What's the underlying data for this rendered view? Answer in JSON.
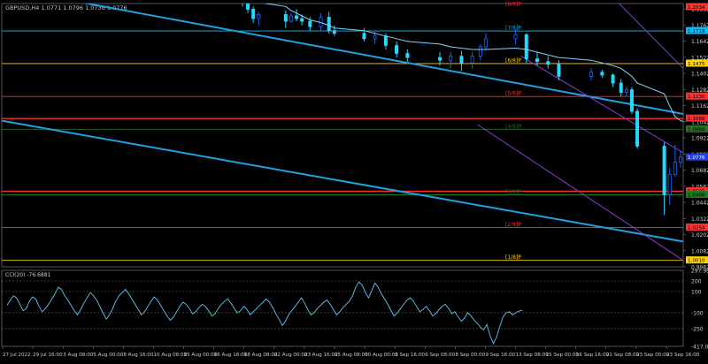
{
  "header": {
    "symbol": "GBPUSD,H4",
    "ohlc": "1.0771 1.0796 1.0736 1.0776"
  },
  "chart_data": [
    {
      "type": "line",
      "name": "price",
      "ylim": [
        0.9962,
        1.1922
      ],
      "y_ticks": [
        1.1882,
        1.1762,
        1.1642,
        1.1522,
        1.1402,
        1.1282,
        1.1162,
        1.1042,
        1.0922,
        1.0802,
        1.0682,
        1.0562,
        1.0442,
        1.0322,
        1.0202,
        1.0082,
        0.9962
      ],
      "x_ticks": [
        "27 Jul 2022",
        "29 Jul 16:00",
        "3 Aug 08:00",
        "5 Aug 00:00",
        "8 Aug 16:00",
        "10 Aug 08:00",
        "15 Aug 00:00",
        "16 Aug 16:00",
        "18 Aug 08:00",
        "22 Aug 00:00",
        "23 Aug 16:00",
        "25 Aug 08:00",
        "30 Aug 00:00",
        "1 Sep 16:00",
        "6 Sep 08:00",
        "8 Sep 00:00",
        "9 Sep 16:00",
        "13 Sep 08:00",
        "15 Sep 00:00",
        "16 Sep 16:00",
        "21 Sep 08:00",
        "23 Sep 00:00",
        "23 Sep 16:00"
      ],
      "current_price": "1.0776",
      "levels": [
        {
          "label": "[8/8]P",
          "price": "1.2034",
          "color": "#ff3333",
          "kind": "murrey"
        },
        {
          "label": "[7/8]P",
          "price": "1.1718",
          "color": "#00bfff",
          "kind": "murrey"
        },
        {
          "label": "[6/8]P",
          "price": "1.1475",
          "color": "#ffd400",
          "kind": "murrey"
        },
        {
          "label": "[5/8]P",
          "price": "1.1230",
          "color": "#ff3333",
          "kind": "murrey"
        },
        {
          "label": "",
          "price": "1.1066",
          "color": "#ff2a2a",
          "kind": "line"
        },
        {
          "label": "[4/8]P",
          "price": "1.0986",
          "color": "#2a6e2a",
          "kind": "murrey"
        },
        {
          "label": "",
          "price": "1.0525",
          "color": "#ff2a2a",
          "kind": "line"
        },
        {
          "label": "[3/8]P",
          "price": "1.0498",
          "color": "#1f7a1f",
          "kind": "murrey"
        },
        {
          "label": "[2/8]P",
          "price": "1.0254",
          "color": "#ff3333",
          "kind": "murrey"
        },
        {
          "label": "[1/8]P",
          "price": "1.0010",
          "color": "#ffd400",
          "kind": "murrey"
        }
      ],
      "candles": [
        {
          "time": "17 Aug",
          "open": 1.2034,
          "high": 1.208,
          "low": 1.1985,
          "close": 1.2
        },
        {
          "time": "18 Aug",
          "open": 1.2,
          "high": 1.201,
          "low": 1.19,
          "close": 1.193
        },
        {
          "time": "18 Aug",
          "open": 1.193,
          "high": 1.195,
          "low": 1.185,
          "close": 1.188
        },
        {
          "time": "19 Aug",
          "open": 1.188,
          "high": 1.19,
          "low": 1.178,
          "close": 1.181
        },
        {
          "time": "19 Aug",
          "open": 1.181,
          "high": 1.186,
          "low": 1.176,
          "close": 1.184
        },
        {
          "time": "22 Aug",
          "open": 1.184,
          "high": 1.187,
          "low": 1.174,
          "close": 1.179
        },
        {
          "time": "22 Aug",
          "open": 1.179,
          "high": 1.185,
          "low": 1.178,
          "close": 1.183
        },
        {
          "time": "23 Aug",
          "open": 1.183,
          "high": 1.188,
          "low": 1.179,
          "close": 1.181
        },
        {
          "time": "23 Aug",
          "open": 1.181,
          "high": 1.184,
          "low": 1.176,
          "close": 1.179
        },
        {
          "time": "24 Aug",
          "open": 1.179,
          "high": 1.182,
          "low": 1.172,
          "close": 1.175
        },
        {
          "time": "25 Aug",
          "open": 1.175,
          "high": 1.185,
          "low": 1.172,
          "close": 1.182
        },
        {
          "time": "26 Aug",
          "open": 1.182,
          "high": 1.186,
          "low": 1.17,
          "close": 1.172
        },
        {
          "time": "26 Aug",
          "open": 1.172,
          "high": 1.176,
          "low": 1.168,
          "close": 1.17
        },
        {
          "time": "29 Aug",
          "open": 1.17,
          "high": 1.174,
          "low": 1.164,
          "close": 1.166
        },
        {
          "time": "30 Aug",
          "open": 1.166,
          "high": 1.172,
          "low": 1.162,
          "close": 1.168
        },
        {
          "time": "31 Aug",
          "open": 1.168,
          "high": 1.17,
          "low": 1.158,
          "close": 1.161
        },
        {
          "time": "1 Sep",
          "open": 1.161,
          "high": 1.164,
          "low": 1.152,
          "close": 1.155
        },
        {
          "time": "2 Sep",
          "open": 1.155,
          "high": 1.158,
          "low": 1.149,
          "close": 1.152
        },
        {
          "time": "5 Sep",
          "open": 1.152,
          "high": 1.156,
          "low": 1.146,
          "close": 1.15
        },
        {
          "time": "6 Sep",
          "open": 1.15,
          "high": 1.156,
          "low": 1.144,
          "close": 1.153
        },
        {
          "time": "7 Sep",
          "open": 1.153,
          "high": 1.157,
          "low": 1.142,
          "close": 1.148
        },
        {
          "time": "8 Sep",
          "open": 1.148,
          "high": 1.156,
          "low": 1.144,
          "close": 1.153
        },
        {
          "time": "9 Sep",
          "open": 1.153,
          "high": 1.162,
          "low": 1.15,
          "close": 1.16
        },
        {
          "time": "9 Sep",
          "open": 1.16,
          "high": 1.17,
          "low": 1.158,
          "close": 1.166
        },
        {
          "time": "12 Sep",
          "open": 1.166,
          "high": 1.173,
          "low": 1.162,
          "close": 1.169
        },
        {
          "time": "13 Sep",
          "open": 1.169,
          "high": 1.17,
          "low": 1.148,
          "close": 1.151
        },
        {
          "time": "14 Sep",
          "open": 1.151,
          "high": 1.156,
          "low": 1.146,
          "close": 1.149
        },
        {
          "time": "15 Sep",
          "open": 1.149,
          "high": 1.153,
          "low": 1.144,
          "close": 1.147
        },
        {
          "time": "16 Sep",
          "open": 1.147,
          "high": 1.15,
          "low": 1.135,
          "close": 1.138
        },
        {
          "time": "19 Sep",
          "open": 1.138,
          "high": 1.144,
          "low": 1.135,
          "close": 1.141
        },
        {
          "time": "20 Sep",
          "open": 1.141,
          "high": 1.143,
          "low": 1.137,
          "close": 1.139
        },
        {
          "time": "21 Sep",
          "open": 1.139,
          "high": 1.14,
          "low": 1.13,
          "close": 1.133
        },
        {
          "time": "22 Sep",
          "open": 1.133,
          "high": 1.136,
          "low": 1.123,
          "close": 1.126
        },
        {
          "time": "22 Sep",
          "open": 1.126,
          "high": 1.13,
          "low": 1.123,
          "close": 1.128
        },
        {
          "time": "23 Sep",
          "open": 1.128,
          "high": 1.13,
          "low": 1.11,
          "close": 1.112
        },
        {
          "time": "23 Sep",
          "open": 1.112,
          "high": 1.114,
          "low": 1.084,
          "close": 1.086
        },
        {
          "time": "26 Sep",
          "open": 1.086,
          "high": 1.089,
          "low": 1.035,
          "close": 1.05
        },
        {
          "time": "26 Sep",
          "open": 1.05,
          "high": 1.07,
          "low": 1.042,
          "close": 1.065
        },
        {
          "time": "27 Sep",
          "open": 1.065,
          "high": 1.087,
          "low": 1.063,
          "close": 1.074
        },
        {
          "time": "27 Sep",
          "open": 1.074,
          "high": 1.083,
          "low": 1.07,
          "close": 1.078
        },
        {
          "time": "28 Sep",
          "open": 1.078,
          "high": 1.081,
          "low": 1.072,
          "close": 1.075
        },
        {
          "time": "28 Sep",
          "open": 1.075,
          "high": 1.08,
          "low": 1.074,
          "close": 1.0776
        }
      ],
      "ma": [
        1.205,
        1.203,
        1.2,
        1.196,
        1.193,
        1.19,
        1.187,
        1.185,
        1.183,
        1.18,
        1.178,
        1.176,
        1.174,
        1.172,
        1.17,
        1.168,
        1.166,
        1.164,
        1.162,
        1.16,
        1.159,
        1.158,
        1.158,
        1.158,
        1.159,
        1.158,
        1.156,
        1.154,
        1.152,
        1.15,
        1.148,
        1.146,
        1.144,
        1.141,
        1.138,
        1.133,
        1.125,
        1.116,
        1.108,
        1.105,
        1.104,
        1.103
      ],
      "trendlines": [
        {
          "color": "#1fa0e0",
          "from": [
            "27 Jul",
            1.204
          ],
          "to": [
            "28 Sep",
            1.11
          ]
        },
        {
          "color": "#1fa0e0",
          "from": [
            "27 Jul",
            1.105
          ],
          "to": [
            "28 Sep",
            1.015
          ]
        },
        {
          "color": "#8a3ad8",
          "from": [
            "13 Sep",
            1.153
          ],
          "to": [
            "28 Sep",
            1.081
          ]
        },
        {
          "color": "#8a3ad8",
          "from": [
            "9 Sep",
            1.102
          ],
          "to": [
            "28 Sep",
            1.001
          ]
        },
        {
          "color": "#8a3ad8",
          "from": [
            "21 Sep",
            1.201
          ],
          "to": [
            "28 Sep",
            1.144
          ]
        }
      ]
    },
    {
      "type": "line",
      "name": "cci",
      "label": "CCI(20) -76.6881",
      "ylim": [
        -417.0,
        300.0
      ],
      "y_ticks": [
        "-417.0563",
        "-250",
        "-100",
        "100",
        "200",
        "297.9903"
      ],
      "y_values": [
        -417.0563,
        -250,
        -100,
        100,
        200,
        297.9903
      ],
      "levels": [
        -250,
        -100,
        100,
        200
      ],
      "values": [
        -30,
        20,
        60,
        40,
        -20,
        -80,
        -60,
        10,
        50,
        30,
        -40,
        -90,
        -60,
        -20,
        30,
        80,
        140,
        120,
        60,
        20,
        -30,
        -80,
        -120,
        -70,
        -10,
        40,
        90,
        60,
        20,
        -40,
        -100,
        -160,
        -120,
        -60,
        10,
        60,
        90,
        120,
        80,
        30,
        -20,
        -70,
        -120,
        -90,
        -40,
        10,
        50,
        20,
        -30,
        -80,
        -130,
        -170,
        -140,
        -90,
        -40,
        0,
        -20,
        -60,
        -110,
        -90,
        -50,
        -20,
        -40,
        -80,
        -130,
        -110,
        -60,
        -20,
        10,
        30,
        -10,
        -60,
        -100,
        -80,
        -40,
        -70,
        -120,
        -90,
        -60,
        -30,
        0,
        30,
        0,
        -50,
        -110,
        -160,
        -220,
        -180,
        -120,
        -80,
        -40,
        0,
        40,
        -10,
        -70,
        -120,
        -100,
        -60,
        -30,
        0,
        20,
        -20,
        -70,
        -120,
        -90,
        -50,
        -20,
        10,
        60,
        140,
        190,
        160,
        90,
        40,
        110,
        180,
        140,
        80,
        30,
        -20,
        -80,
        -130,
        -100,
        -60,
        -20,
        20,
        40,
        10,
        -40,
        -90,
        -70,
        -40,
        -80,
        -130,
        -110,
        -70,
        -40,
        -20,
        -60,
        -110,
        -90,
        -140,
        -180,
        -150,
        -100,
        -130,
        -170,
        -200,
        -240,
        -260,
        -210,
        -320,
        -390,
        -330,
        -230,
        -140,
        -100,
        -90,
        -120,
        -100,
        -85,
        -77
      ]
    }
  ]
}
